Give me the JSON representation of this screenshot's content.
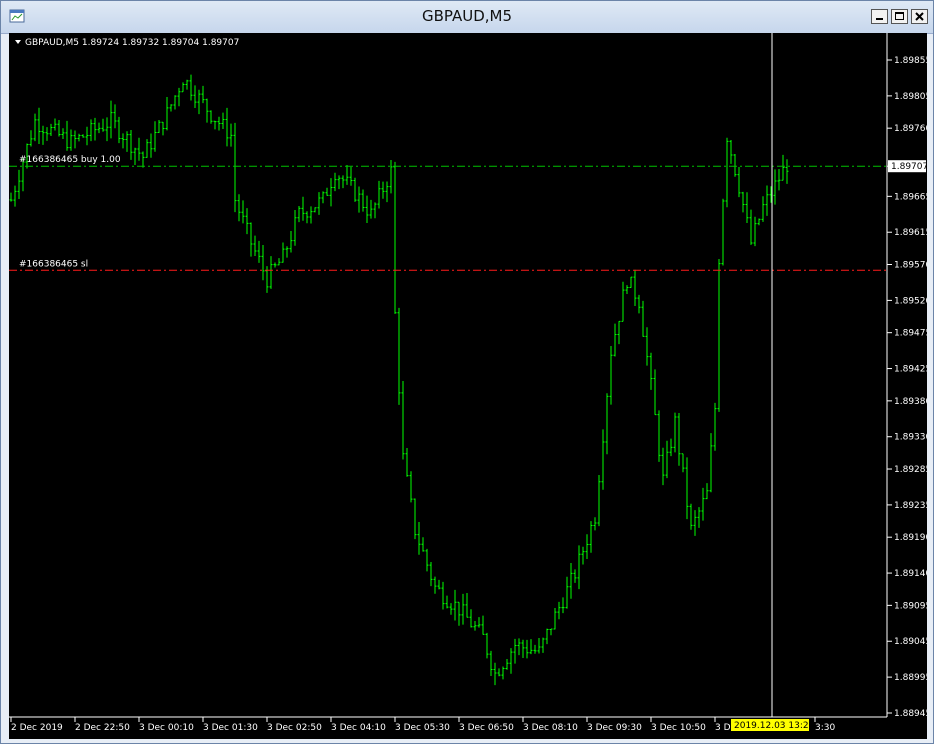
{
  "window": {
    "title": "GBPAUD,M5",
    "icon": "chart-window-icon"
  },
  "chart_header": {
    "info": "GBPAUD,M5  1.89724 1.89732 1.89704 1.89707"
  },
  "orders": [
    {
      "label": "#166386465 buy 1.00",
      "price": 1.89707,
      "color": "#00c000"
    },
    {
      "label": "#166386465 sl",
      "price": 1.89562,
      "color": "#ff1a1a"
    }
  ],
  "price_axis": {
    "ticks": [
      "1.89855",
      "1.89805",
      "1.89760",
      "1.89707",
      "1.89665",
      "1.89615",
      "1.89570",
      "1.89520",
      "1.89475",
      "1.89425",
      "1.89380",
      "1.89330",
      "1.89285",
      "1.89235",
      "1.89190",
      "1.89140",
      "1.89095",
      "1.89045",
      "1.88995",
      "1.88945"
    ],
    "current_price": "1.89707"
  },
  "time_axis": {
    "labels": [
      "2 Dec 2019",
      "2 Dec 22:50",
      "3 Dec 00:10",
      "3 Dec 01:30",
      "3 Dec 02:50",
      "3 Dec 04:10",
      "3 Dec 05:30",
      "3 Dec 06:50",
      "3 Dec 08:10",
      "3 Dec 09:30",
      "3 Dec 10:50",
      "3 De",
      "3:30"
    ],
    "crosshair_label": "2019.12.03 13:20"
  },
  "colors": {
    "background": "#000000",
    "bar": "#00ff00",
    "axis": "#ffffff",
    "buy_line": "#00c000",
    "sl_line": "#ff1a1a",
    "crosshair_tag": "#ffff00"
  },
  "chart_data": {
    "type": "line",
    "title": "GBPAUD,M5",
    "symbol": "GBPAUD",
    "timeframe": "M5",
    "ohlc_latest": {
      "open": 1.89724,
      "high": 1.89732,
      "low": 1.89704,
      "close": 1.89707
    },
    "ylim": [
      1.88945,
      1.89855
    ],
    "x": [
      "2 Dec 2019",
      "2 Dec 22:50",
      "3 Dec 00:10",
      "3 Dec 01:30",
      "3 Dec 02:50",
      "3 Dec 04:10",
      "3 Dec 05:30",
      "3 Dec 06:50",
      "3 Dec 08:10",
      "3 Dec 09:30",
      "3 Dec 10:50",
      "3 Dec 12:10",
      "3 Dec 13:30"
    ],
    "series": [
      {
        "values": [
          1.897,
          1.8977,
          1.898,
          1.896,
          1.8968,
          1.8966,
          1.8935,
          1.8903,
          1.8907,
          1.8953,
          1.893,
          1.897,
          1.8971
        ]
      }
    ]
  }
}
